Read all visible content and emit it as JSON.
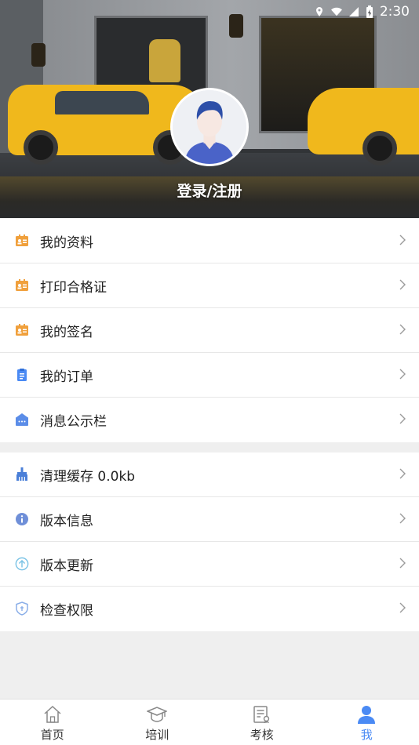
{
  "status_bar": {
    "time": "2:30"
  },
  "profile": {
    "login_label": "登录/注册"
  },
  "menu_group_1": [
    {
      "label": "我的资料",
      "icon": "id-card-icon",
      "color": "#f0a03c"
    },
    {
      "label": "打印合格证",
      "icon": "id-card-icon",
      "color": "#f0a03c"
    },
    {
      "label": "我的签名",
      "icon": "id-card-icon",
      "color": "#f0a03c"
    },
    {
      "label": "我的订单",
      "icon": "clipboard-icon",
      "color": "#4a8af4"
    },
    {
      "label": "消息公示栏",
      "icon": "bulletin-icon",
      "color": "#5b8de8"
    }
  ],
  "menu_group_2": [
    {
      "label": "清理缓存 0.0kb",
      "icon": "broom-icon",
      "color": "#4a7fd8"
    },
    {
      "label": "版本信息",
      "icon": "info-icon",
      "color": "#6f8fd8"
    },
    {
      "label": "版本更新",
      "icon": "upload-circle-icon",
      "color": "#7cc4e6"
    },
    {
      "label": "检查权限",
      "icon": "shield-icon",
      "color": "#8aaee8"
    }
  ],
  "bottom_nav": [
    {
      "label": "首页",
      "icon": "home-icon",
      "active": false
    },
    {
      "label": "培训",
      "icon": "graduation-cap-icon",
      "active": false
    },
    {
      "label": "考核",
      "icon": "exam-icon",
      "active": false
    },
    {
      "label": "我",
      "icon": "person-icon",
      "active": true
    }
  ],
  "colors": {
    "accent": "#4a8af4",
    "orange": "#f0a03c",
    "divider": "#e7e7e7"
  }
}
